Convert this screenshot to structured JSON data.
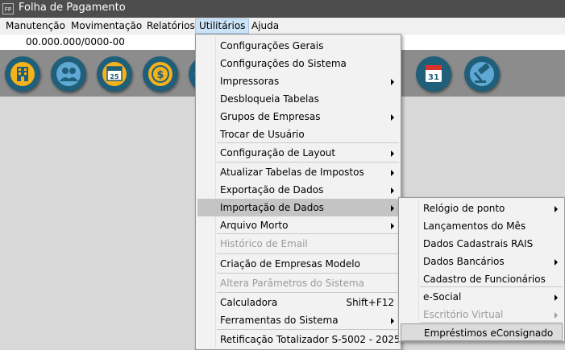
{
  "window": {
    "app_icon_text": "FP",
    "title": "Folha de Pagamento"
  },
  "menubar": [
    "Manutenção",
    "Movimentação",
    "Relatórios",
    "Utilitários",
    "Ajuda"
  ],
  "infobar": {
    "company_code": "00.000.000/0000-00"
  },
  "toolbar": {
    "icons": [
      "building-icon",
      "users-icon",
      "calendar-25-icon",
      "dollar-coin-icon",
      "partial-icon",
      "calendar-31-icon",
      "gavel-icon"
    ],
    "colors": {
      "circle": "#1f5f7a",
      "yellow": "#f5b21b",
      "light_blue": "#5fa8d3",
      "red": "#d9342b"
    }
  },
  "utilitarios_menu": {
    "items": [
      {
        "label": "Configurações Gerais"
      },
      {
        "label": "Configurações do Sistema"
      },
      {
        "label": "Impressoras",
        "submenu": true
      },
      {
        "label": "Desbloqueia Tabelas"
      },
      {
        "label": "Grupos de Empresas",
        "submenu": true
      },
      {
        "label": "Trocar de Usuário"
      },
      {
        "label": "Configuração de Layout",
        "submenu": true
      },
      {
        "label": "Atualizar Tabelas de Impostos",
        "submenu": true
      },
      {
        "label": "Exportação de Dados",
        "submenu": true
      },
      {
        "label": "Importação de Dados",
        "submenu": true,
        "highlighted": true
      },
      {
        "label": "Arquivo Morto",
        "submenu": true
      },
      {
        "label": "Histórico de Email",
        "disabled": true
      },
      {
        "label": "Criação de Empresas Modelo"
      },
      {
        "label": "Altera Parâmetros do Sistema",
        "disabled": true
      },
      {
        "label": "Calculadora",
        "shortcut": "Shift+F12"
      },
      {
        "label": "Ferramentas do Sistema",
        "submenu": true
      },
      {
        "label": "Retificação Totalizador S-5002 - 2025"
      }
    ]
  },
  "importacao_submenu": {
    "items": [
      {
        "label": "Relógio de ponto",
        "submenu": true
      },
      {
        "label": "Lançamentos do Mês"
      },
      {
        "label": "Dados Cadastrais RAIS"
      },
      {
        "label": "Dados Bancários",
        "submenu": true
      },
      {
        "label": "Cadastro de Funcionários"
      },
      {
        "label": "e-Social",
        "submenu": true
      },
      {
        "label": "Escritório Virtual",
        "submenu": true,
        "disabled": true
      },
      {
        "label": "Empréstimos eConsignado",
        "highlighted": true
      }
    ]
  }
}
